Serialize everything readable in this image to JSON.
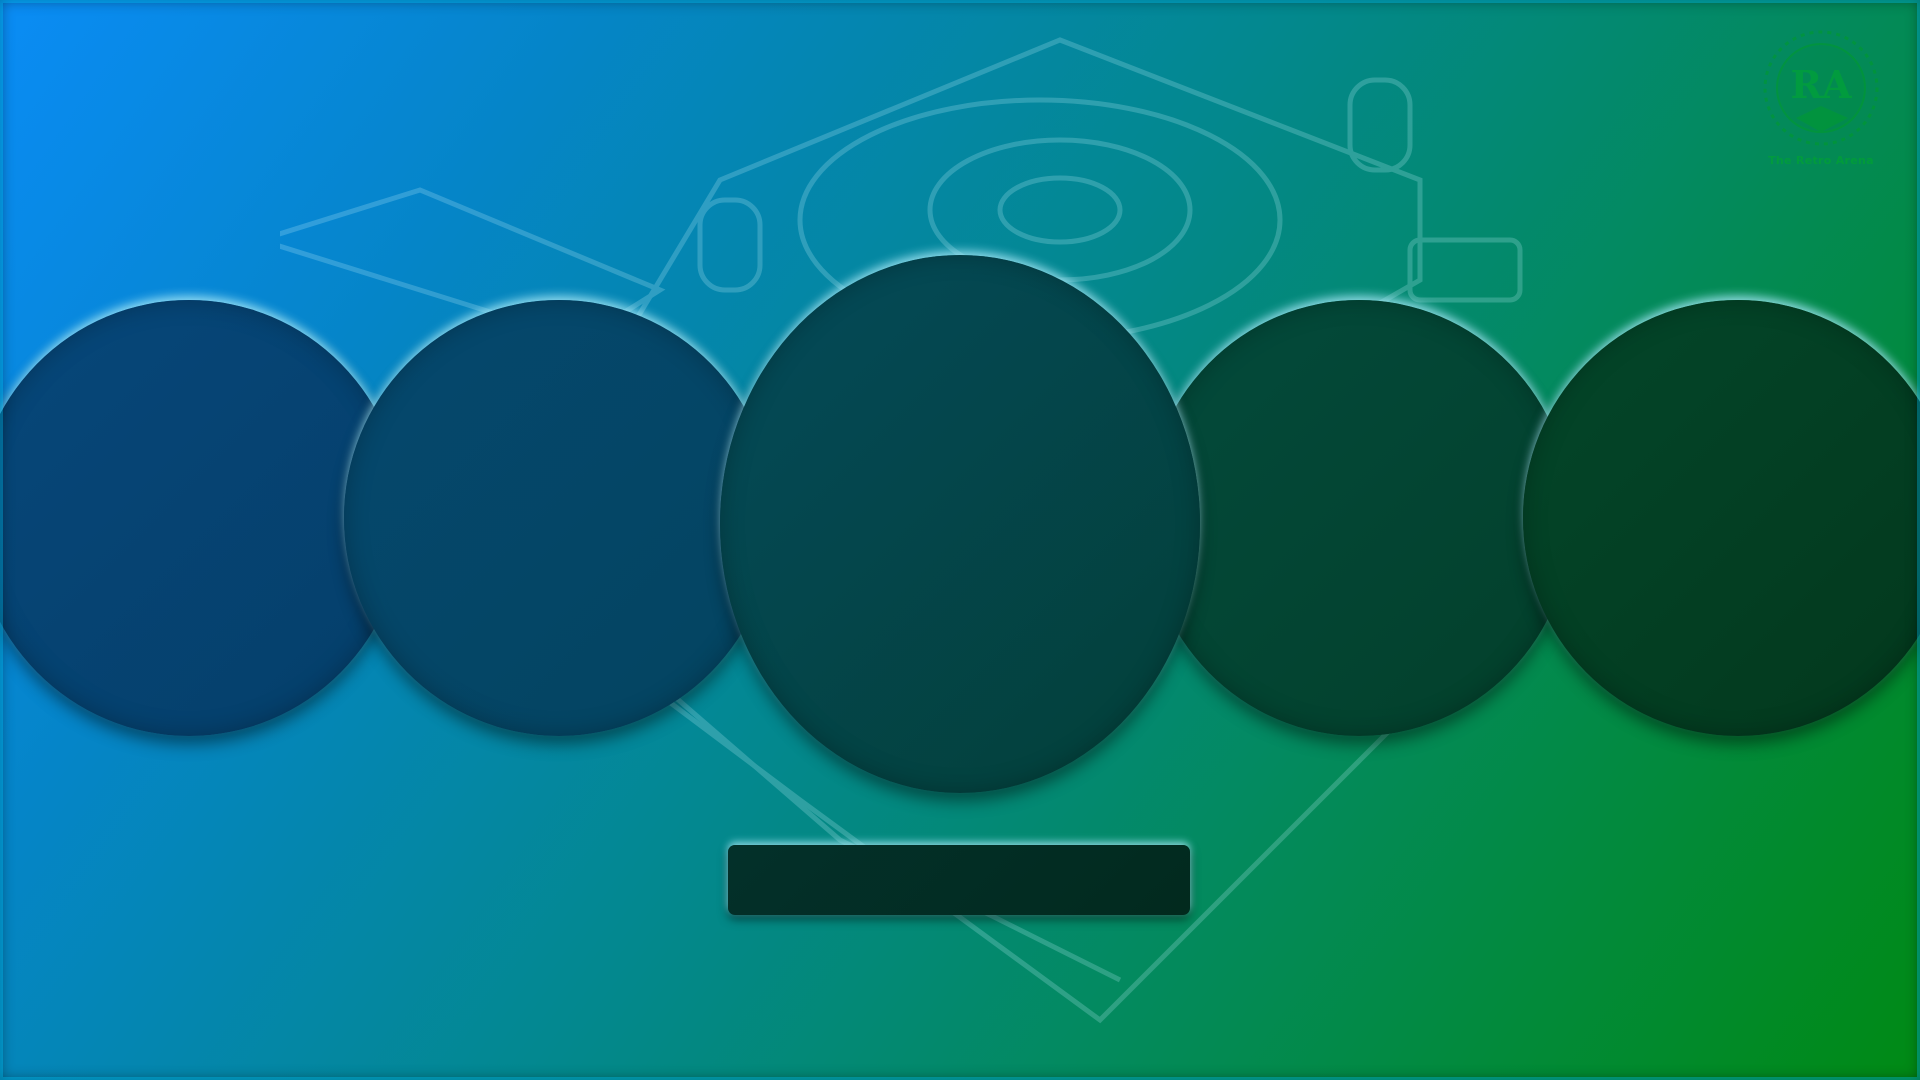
{
  "logo": {
    "text": "The Retro Arena",
    "monogram": "RA"
  },
  "carousel": {
    "items": [
      {
        "label": ""
      },
      {
        "label": ""
      },
      {
        "label": ""
      },
      {
        "label": ""
      },
      {
        "label": ""
      }
    ],
    "selected_index": 2
  },
  "selected_title": {
    "label": ""
  },
  "colors": {
    "gradient_start": "#0a8cf5",
    "gradient_end": "#008a14",
    "tile_glow": "#aaf0ff"
  }
}
